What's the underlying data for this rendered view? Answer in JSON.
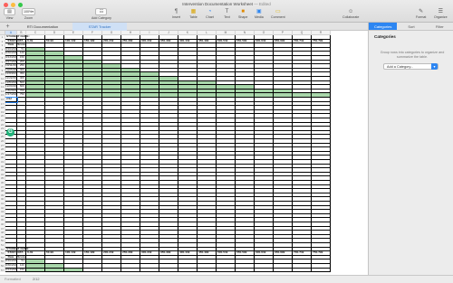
{
  "window": {
    "title": "Intervention Documentation Worksheet",
    "edited": "— Edited"
  },
  "toolbar": {
    "view": "View",
    "zoom_value": "100%",
    "zoom": "Zoom",
    "add_category": "Add Category",
    "insert": "Insert",
    "table": "Table",
    "chart": "Chart",
    "text": "Text",
    "shape": "Shape",
    "media": "Media",
    "comment": "Comment",
    "collaborate": "Collaborate",
    "format": "Format",
    "organize": "Organize"
  },
  "sheets": {
    "add": "+",
    "tabs": [
      "RTI Documentation",
      "STAR Tracker"
    ]
  },
  "columns": [
    "A",
    "B",
    "C",
    "D",
    "E",
    "F",
    "G",
    "H",
    "I",
    "J",
    "K",
    "L",
    "M",
    "N",
    "O",
    "P",
    "Q",
    "R"
  ],
  "row_numbers": [
    "1",
    "2",
    "3",
    "4",
    "5",
    "6",
    "7",
    "8",
    "9",
    "10",
    "11",
    "12",
    "13",
    "14",
    "15",
    "16",
    "17",
    "18",
    "19",
    "20",
    "21",
    "22",
    "23",
    "24",
    "25",
    "26",
    "27",
    "28",
    "29",
    "30",
    "31",
    "32",
    "33",
    "34",
    "35",
    "36",
    "37",
    "38",
    "39",
    "40",
    "41",
    "42",
    "43",
    "44",
    "45",
    "46",
    "47",
    "48",
    "49",
    "50",
    "51",
    "52",
    "53",
    "54",
    "55",
    "56",
    "57"
  ],
  "table1": {
    "student_label": "STUDENT NAME:",
    "star_data": "STAR DATA",
    "date_label": "Date",
    "score_label": "Score",
    "ranges": [
      "0-49",
      "50-99",
      "100-149",
      "150-199",
      "200-249",
      "250-299",
      "300-349",
      "350-399",
      "400-449",
      "450-499",
      "500-549",
      "550-599",
      "600-649",
      "650-699",
      "700-749",
      "750-799"
    ],
    "rows": [
      {
        "date": "8/16/2023",
        "score": "51",
        "fill": 1
      },
      {
        "date": "8/30/2023",
        "score": "120",
        "fill": 2
      },
      {
        "date": "9/13/2023",
        "score": "150",
        "fill": 3
      },
      {
        "date": "9/27/2023",
        "score": "200",
        "fill": 4
      },
      {
        "date": "10/11/2023",
        "score": "250",
        "fill": 5
      },
      {
        "date": "10/25/2023",
        "score": "300",
        "fill": 6
      },
      {
        "date": "11/8/2023",
        "score": "350",
        "fill": 7
      },
      {
        "date": "11/22/2023",
        "score": "400",
        "fill": 8
      },
      {
        "date": "12/6/2023",
        "score": "500",
        "fill": 10
      },
      {
        "date": "12/20/2023",
        "score": "600",
        "fill": 12
      },
      {
        "date": "1/3/2024",
        "score": "700",
        "fill": 14
      },
      {
        "date": "1/17/2024",
        "score": "750",
        "fill": 16
      }
    ],
    "extra_cell": "2/12"
  },
  "table2": {
    "student_label": "STUDENT NAME:",
    "star_data": "STAR DATA",
    "date_label": "Date",
    "score_label": "Score",
    "ranges": [
      "0-49",
      "50-99",
      "100-149",
      "150-199",
      "200-249",
      "250-299",
      "300-349",
      "350-399",
      "400-449",
      "450-499",
      "500-549",
      "550-599",
      "600-649",
      "650-699",
      "700-749",
      "750-799"
    ],
    "rows": [
      {
        "date": "8/16/2023",
        "score": "51",
        "fill": 1
      },
      {
        "date": "8/30/2023",
        "score": "120",
        "fill": 2
      },
      {
        "date": "9/13/2023",
        "score": "150",
        "fill": 3
      }
    ]
  },
  "inspector": {
    "tabs": [
      "Categories",
      "Sort",
      "Filter"
    ],
    "title": "Categories",
    "description": "Group rows into categories to organize and summarize the table.",
    "add_category": "Add a Category..."
  },
  "status": {
    "format": "Formatted",
    "value": "2/12"
  },
  "colors": {
    "fill": "#a9d7ab",
    "accent": "#2d86f2",
    "grammarly": "#1fb37a"
  }
}
